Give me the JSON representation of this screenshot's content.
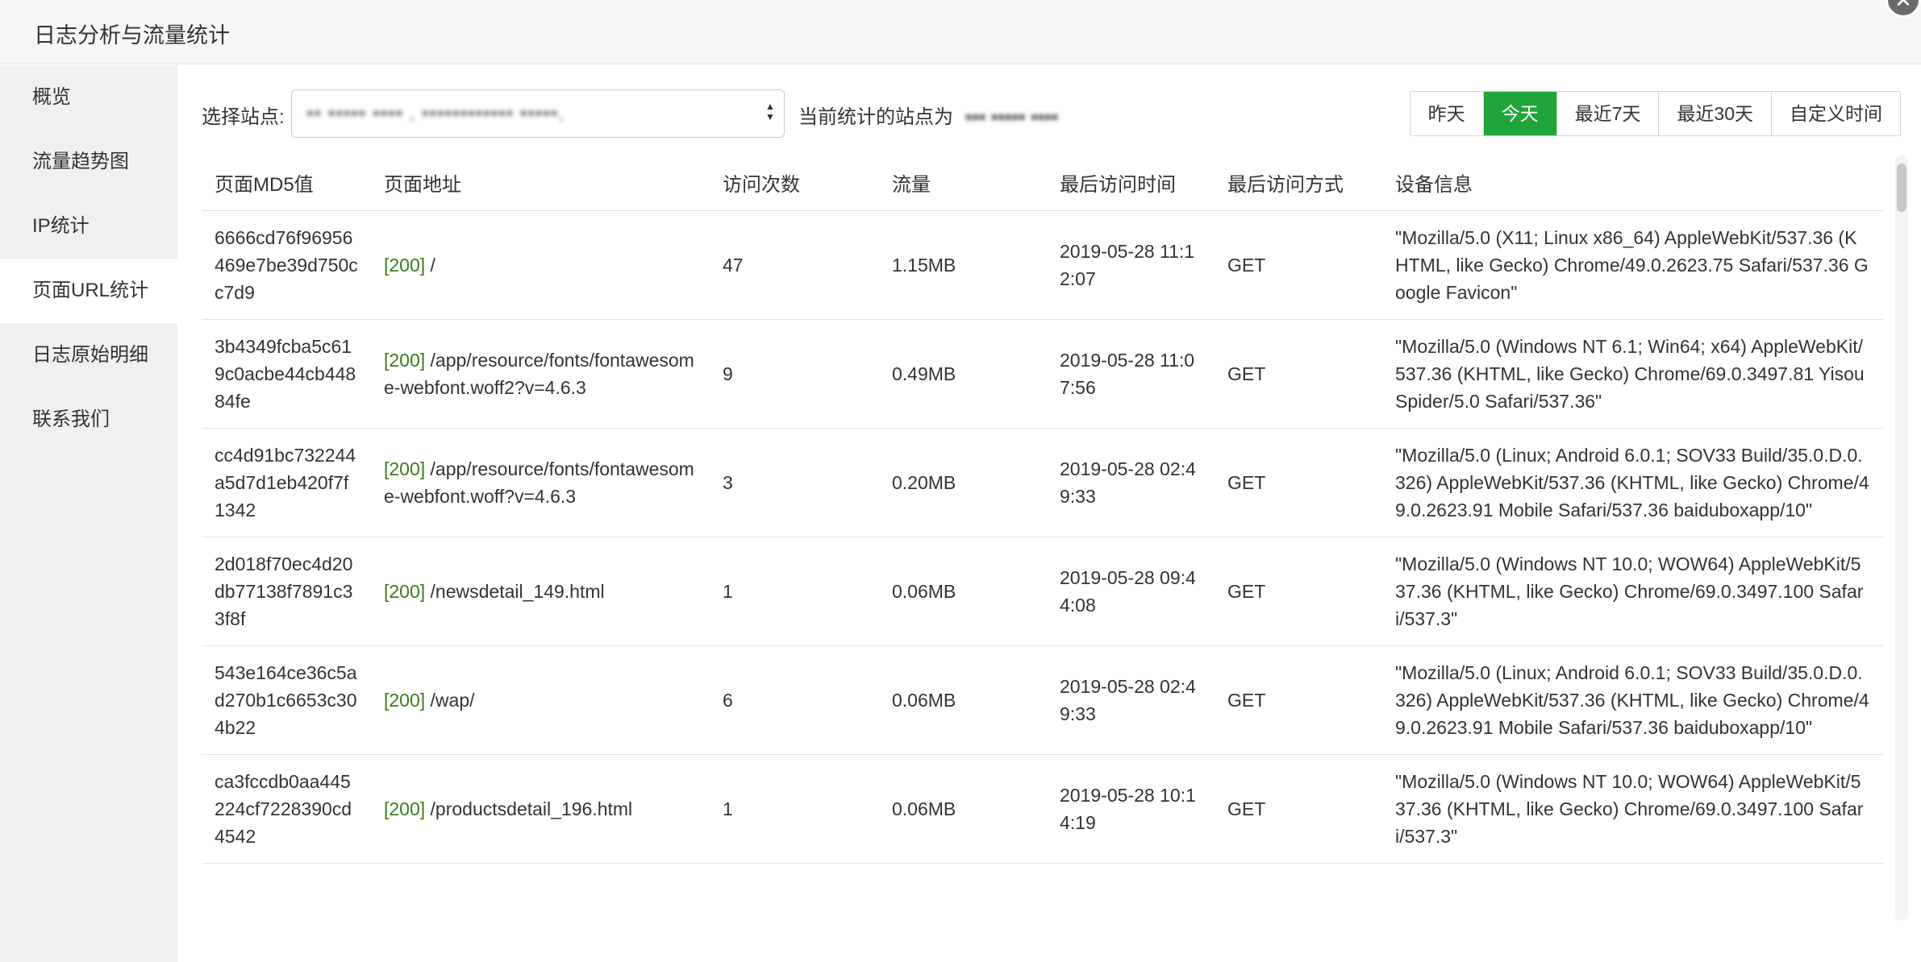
{
  "window": {
    "title": "日志分析与流量统计"
  },
  "sidebar": {
    "items": [
      {
        "label": "概览",
        "active": false
      },
      {
        "label": "流量趋势图",
        "active": false
      },
      {
        "label": "IP统计",
        "active": false
      },
      {
        "label": "页面URL统计",
        "active": true
      },
      {
        "label": "日志原始明细",
        "active": false
      },
      {
        "label": "联系我们",
        "active": false
      }
    ]
  },
  "toolbar": {
    "site_label": "选择站点:",
    "site_value": "▪▪ ▪▪▪▪▪ ▪▪▪▪ , ▪▪▪▪▪▪▪▪▪▪▪▪ ▪▪▪▪▪,",
    "current_site_label": "当前统计的站点为",
    "current_site_value": "▪▪▪ ▪▪▪▪▪ ▪▪▪▪"
  },
  "range_buttons": [
    {
      "label": "昨天",
      "active": false
    },
    {
      "label": "今天",
      "active": true
    },
    {
      "label": "最近7天",
      "active": false
    },
    {
      "label": "最近30天",
      "active": false
    },
    {
      "label": "自定义时间",
      "active": false
    }
  ],
  "table": {
    "headers": [
      "页面MD5值",
      "页面地址",
      "访问次数",
      "流量",
      "最后访问时间",
      "最后访问方式",
      "设备信息"
    ],
    "rows": [
      {
        "md5": "6666cd76f96956469e7be39d750cc7d9",
        "status": "[200]",
        "url": "/",
        "visits": "47",
        "traffic": "1.15MB",
        "last_time": "2019-05-28 11:12:07",
        "method": "GET",
        "ua": "\"Mozilla/5.0 (X11; Linux x86_64) AppleWebKit/537.36 (KHTML, like Gecko) Chrome/49.0.2623.75 Safari/537.36 Google Favicon\""
      },
      {
        "md5": "3b4349fcba5c619c0acbe44cb44884fe",
        "status": "[200]",
        "url": "/app/resource/fonts/fontawesome-webfont.woff2?v=4.6.3",
        "visits": "9",
        "traffic": "0.49MB",
        "last_time": "2019-05-28 11:07:56",
        "method": "GET",
        "ua": "\"Mozilla/5.0 (Windows NT 6.1; Win64; x64) AppleWebKit/537.36 (KHTML, like Gecko) Chrome/69.0.3497.81 YisouSpider/5.0 Safari/537.36\""
      },
      {
        "md5": "cc4d91bc732244a5d7d1eb420f7f1342",
        "status": "[200]",
        "url": "/app/resource/fonts/fontawesome-webfont.woff?v=4.6.3",
        "visits": "3",
        "traffic": "0.20MB",
        "last_time": "2019-05-28 02:49:33",
        "method": "GET",
        "ua": "\"Mozilla/5.0 (Linux; Android 6.0.1; SOV33 Build/35.0.D.0.326) AppleWebKit/537.36 (KHTML, like Gecko) Chrome/49.0.2623.91 Mobile Safari/537.36 baiduboxapp/10\""
      },
      {
        "md5": "2d018f70ec4d20db77138f7891c33f8f",
        "status": "[200]",
        "url": "/newsdetail_149.html",
        "visits": "1",
        "traffic": "0.06MB",
        "last_time": "2019-05-28 09:44:08",
        "method": "GET",
        "ua": "\"Mozilla/5.0 (Windows NT 10.0; WOW64) AppleWebKit/537.36 (KHTML, like Gecko) Chrome/69.0.3497.100 Safari/537.3\""
      },
      {
        "md5": "543e164ce36c5ad270b1c6653c304b22",
        "status": "[200]",
        "url": "/wap/",
        "visits": "6",
        "traffic": "0.06MB",
        "last_time": "2019-05-28 02:49:33",
        "method": "GET",
        "ua": "\"Mozilla/5.0 (Linux; Android 6.0.1; SOV33 Build/35.0.D.0.326) AppleWebKit/537.36 (KHTML, like Gecko) Chrome/49.0.2623.91 Mobile Safari/537.36 baiduboxapp/10\""
      },
      {
        "md5": "ca3fccdb0aa445224cf7228390cd4542",
        "status": "[200]",
        "url": "/productsdetail_196.html",
        "visits": "1",
        "traffic": "0.06MB",
        "last_time": "2019-05-28 10:14:19",
        "method": "GET",
        "ua": "\"Mozilla/5.0 (Windows NT 10.0; WOW64) AppleWebKit/537.36 (KHTML, like Gecko) Chrome/69.0.3497.100 Safari/537.3\""
      }
    ]
  },
  "colors": {
    "accent": "#20a53a",
    "status_text": "#3c7a1f",
    "sidebar_bg": "#f0f0f0"
  }
}
